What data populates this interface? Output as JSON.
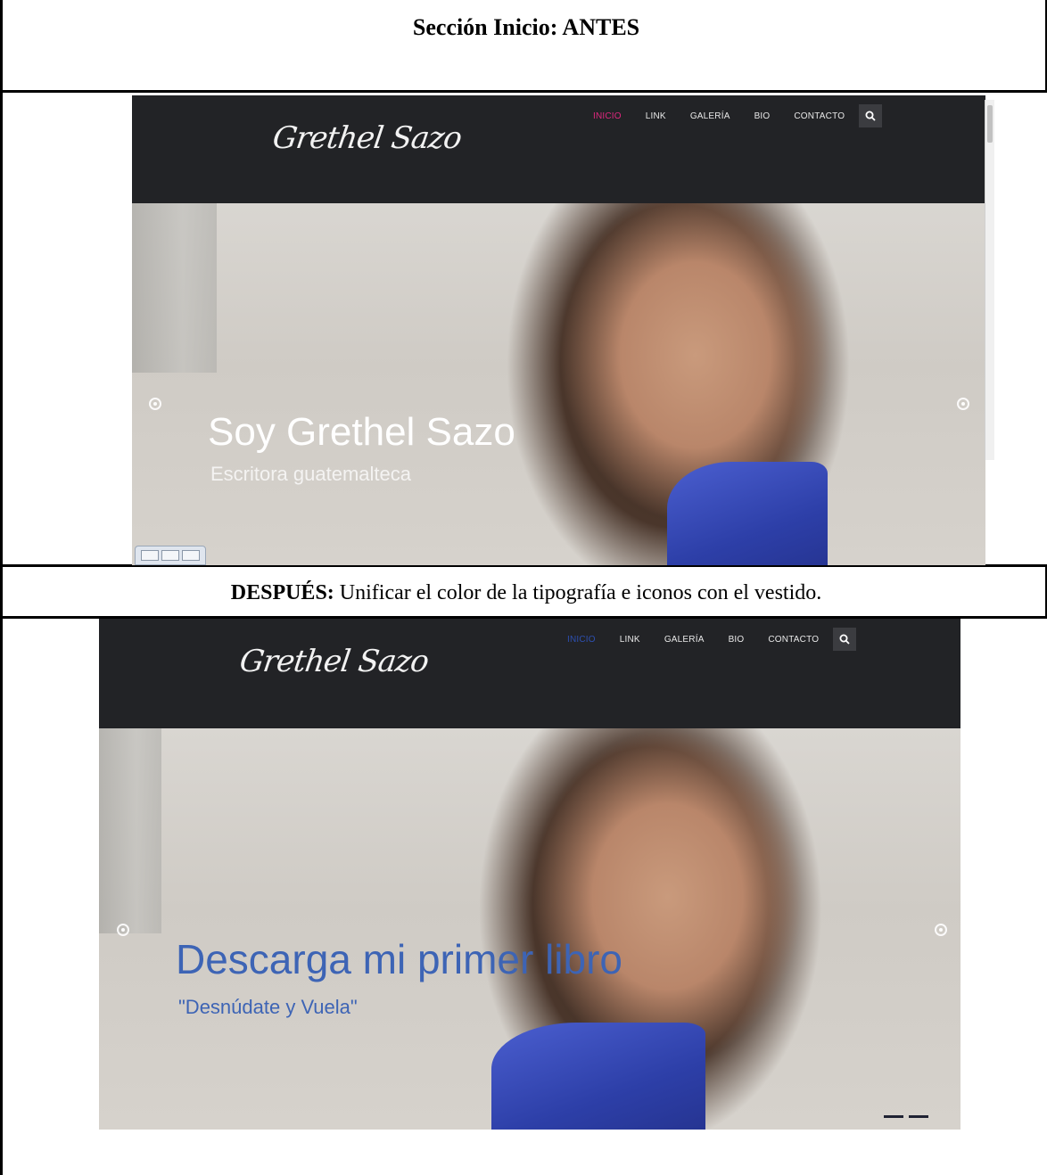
{
  "document": {
    "before_heading": "Sección Inicio: ANTES",
    "after_label": "DESPUÉS:",
    "after_text": " Unificar el color de la tipografía e iconos con el vestido."
  },
  "before_site": {
    "logo": "Grethel Sazo",
    "nav": [
      "INICIO",
      "LINK",
      "GALERÍA",
      "BIO",
      "CONTACTO"
    ],
    "active_color": "#e0277e",
    "hero_title": "Soy Grethel Sazo",
    "hero_subtitle": "Escritora guatemalteca",
    "title_color": "#ffffff"
  },
  "after_site": {
    "logo": "Grethel Sazo",
    "nav": [
      "INICIO",
      "LINK",
      "GALERÍA",
      "BIO",
      "CONTACTO"
    ],
    "active_color": "#2d4fb0",
    "hero_title": "Descarga mi primer libro",
    "hero_subtitle": "\"Desnúdate y Vuela\"",
    "title_color": "#3d64b5"
  },
  "icons": {
    "search": "search-icon",
    "slider_prev": "circle-arrow-left-icon",
    "slider_next": "circle-arrow-right-icon"
  }
}
